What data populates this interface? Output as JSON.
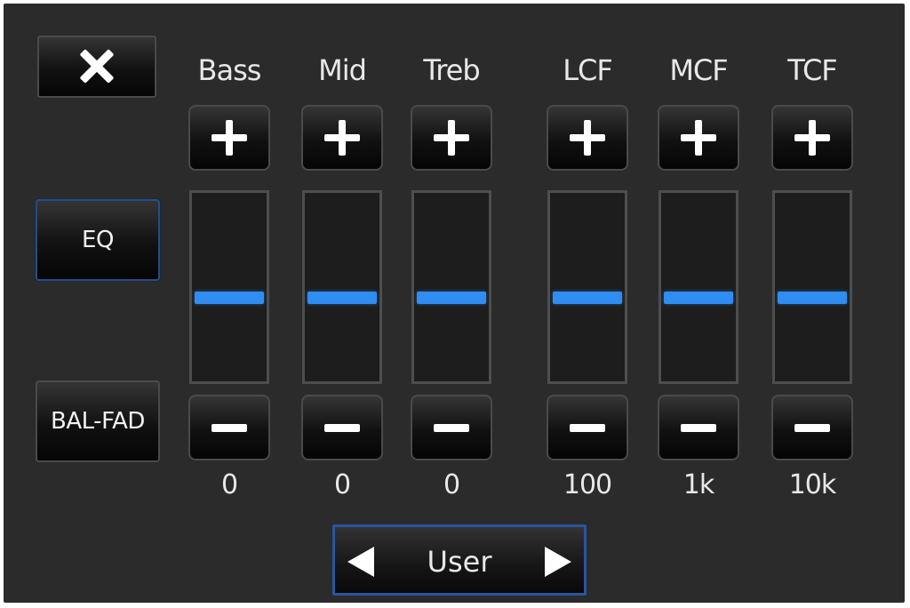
{
  "close_button": {
    "icon": "close-icon"
  },
  "sidebar": {
    "eq_label": "EQ",
    "balfad_label": "BAL-FAD"
  },
  "bands": [
    {
      "label": "Bass",
      "value": "0",
      "level": 0.5
    },
    {
      "label": "Mid",
      "value": "0",
      "level": 0.5
    },
    {
      "label": "Treb",
      "value": "0",
      "level": 0.5
    },
    {
      "label": "LCF",
      "value": "100",
      "level": 0.5
    },
    {
      "label": "MCF",
      "value": "1k",
      "level": 0.5
    },
    {
      "label": "TCF",
      "value": "10k",
      "level": 0.5
    }
  ],
  "preset": {
    "label": "User",
    "prev_icon": "arrow-left-icon",
    "next_icon": "arrow-right-icon"
  },
  "colors": {
    "background": "#2b2b2b",
    "accent": "#2f8cf0",
    "eq_border": "#2a4c7e",
    "preset_border": "#2a55a0"
  }
}
